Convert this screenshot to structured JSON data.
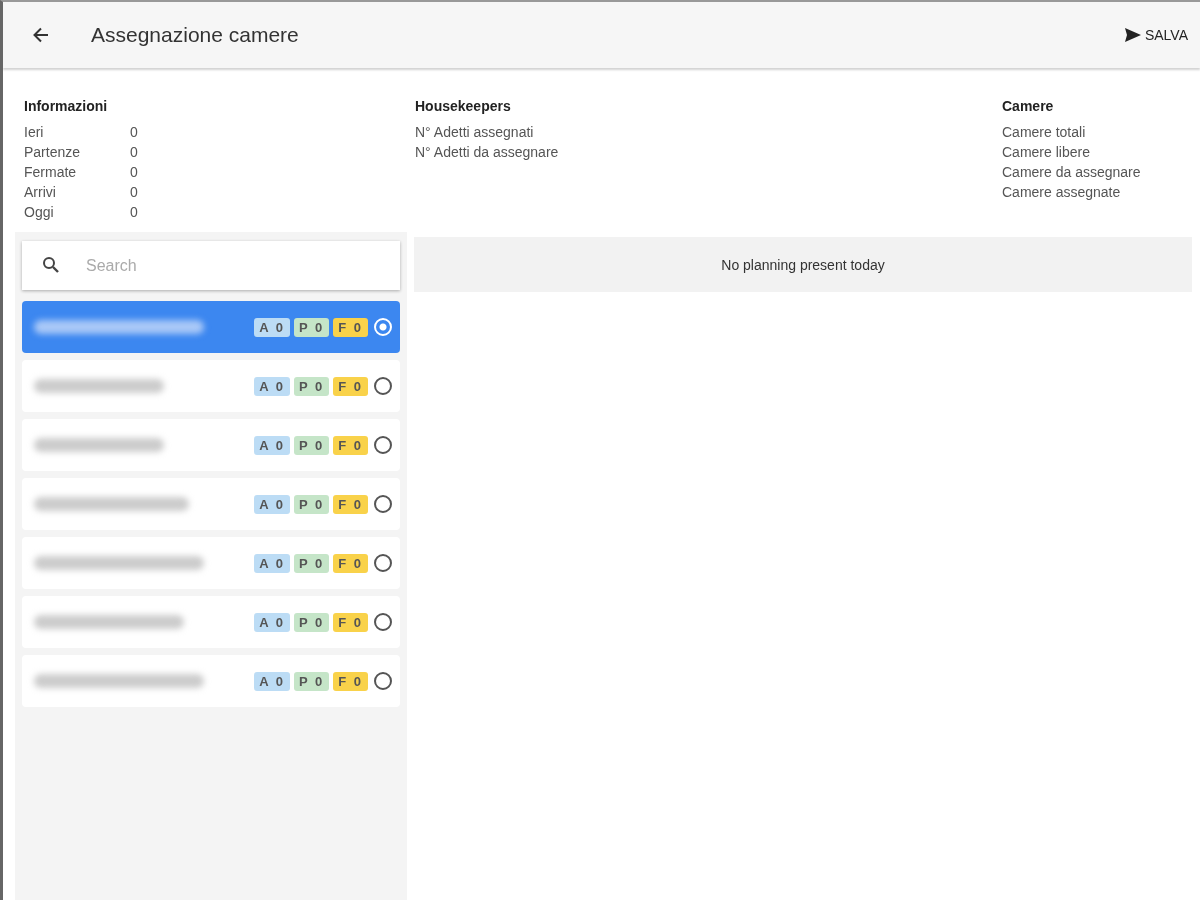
{
  "header": {
    "title": "Assegnazione camere",
    "save_label": "SALVA"
  },
  "info": {
    "title": "Informazioni",
    "rows": [
      {
        "label": "Ieri",
        "value": "0"
      },
      {
        "label": "Partenze",
        "value": "0"
      },
      {
        "label": "Fermate",
        "value": "0"
      },
      {
        "label": "Arrivi",
        "value": "0"
      },
      {
        "label": "Oggi",
        "value": "0"
      }
    ]
  },
  "housekeepers_info": {
    "title": "Housekeepers",
    "rows": [
      "N° Adetti assegnati",
      "N° Adetti da assegnare"
    ]
  },
  "rooms_info": {
    "title": "Camere",
    "rows": [
      "Camere totali",
      "Camere libere",
      "Camere da assegnare",
      "Camere assegnate"
    ]
  },
  "search": {
    "placeholder": "Search"
  },
  "housekeepers": [
    {
      "selected": true,
      "badges": [
        {
          "text": "A 0",
          "color": "#bcdcf5"
        },
        {
          "text": "P 0",
          "color": "#c5e5c8"
        },
        {
          "text": "F 0",
          "color": "#f9d24a"
        }
      ]
    },
    {
      "selected": false,
      "badges": [
        {
          "text": "A 0",
          "color": "#bcdcf5"
        },
        {
          "text": "P 0",
          "color": "#c5e5c8"
        },
        {
          "text": "F 0",
          "color": "#f9d24a"
        }
      ]
    },
    {
      "selected": false,
      "badges": [
        {
          "text": "A 0",
          "color": "#bcdcf5"
        },
        {
          "text": "P 0",
          "color": "#c5e5c8"
        },
        {
          "text": "F 0",
          "color": "#f9d24a"
        }
      ]
    },
    {
      "selected": false,
      "badges": [
        {
          "text": "A 0",
          "color": "#bcdcf5"
        },
        {
          "text": "P 0",
          "color": "#c5e5c8"
        },
        {
          "text": "F 0",
          "color": "#f9d24a"
        }
      ]
    },
    {
      "selected": false,
      "badges": [
        {
          "text": "A 0",
          "color": "#bcdcf5"
        },
        {
          "text": "P 0",
          "color": "#c5e5c8"
        },
        {
          "text": "F 0",
          "color": "#f9d24a"
        }
      ]
    },
    {
      "selected": false,
      "badges": [
        {
          "text": "A 0",
          "color": "#bcdcf5"
        },
        {
          "text": "P 0",
          "color": "#c5e5c8"
        },
        {
          "text": "F 0",
          "color": "#f9d24a"
        }
      ]
    },
    {
      "selected": false,
      "badges": [
        {
          "text": "A 0",
          "color": "#bcdcf5"
        },
        {
          "text": "P 0",
          "color": "#c5e5c8"
        },
        {
          "text": "F 0",
          "color": "#f9d24a"
        }
      ]
    }
  ],
  "planning": {
    "message": "No planning present today"
  }
}
